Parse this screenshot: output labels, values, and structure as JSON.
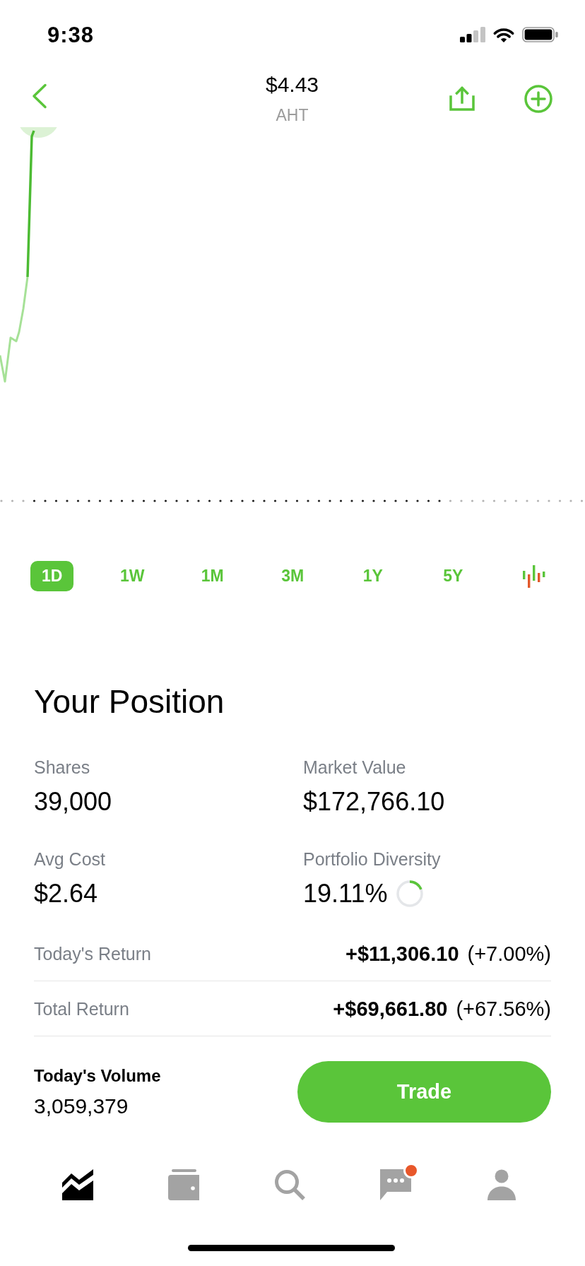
{
  "status_bar": {
    "time": "9:38"
  },
  "header": {
    "price": "$4.43",
    "symbol": "AHT"
  },
  "time_ranges": [
    {
      "label": "1D",
      "selected": true
    },
    {
      "label": "1W",
      "selected": false
    },
    {
      "label": "1M",
      "selected": false
    },
    {
      "label": "3M",
      "selected": false
    },
    {
      "label": "1Y",
      "selected": false
    },
    {
      "label": "5Y",
      "selected": false
    }
  ],
  "position": {
    "title": "Your Position",
    "stats": [
      {
        "label": "Shares",
        "value": "39,000"
      },
      {
        "label": "Market Value",
        "value": "$172,766.10"
      },
      {
        "label": "Avg Cost",
        "value": "$2.64"
      },
      {
        "label": "Portfolio Diversity",
        "value": "19.11%",
        "level": 0.1911
      }
    ]
  },
  "returns": [
    {
      "label": "Today's Return",
      "amount": "+$11,306.10",
      "percent": "(+7.00%)"
    },
    {
      "label": "Total Return",
      "amount": "+$69,661.80",
      "percent": "(+67.56%)"
    }
  ],
  "volume": {
    "label": "Today's Volume",
    "value": "3,059,379"
  },
  "trade_button": {
    "label": "Trade"
  },
  "tab_bar": {
    "items": [
      {
        "kind": "chart",
        "selected": true,
        "badge": false
      },
      {
        "kind": "wallet",
        "selected": false,
        "badge": false
      },
      {
        "kind": "search",
        "selected": false,
        "badge": false
      },
      {
        "kind": "messages",
        "selected": false,
        "badge": true
      },
      {
        "kind": "profile",
        "selected": false,
        "badge": false
      }
    ]
  }
}
